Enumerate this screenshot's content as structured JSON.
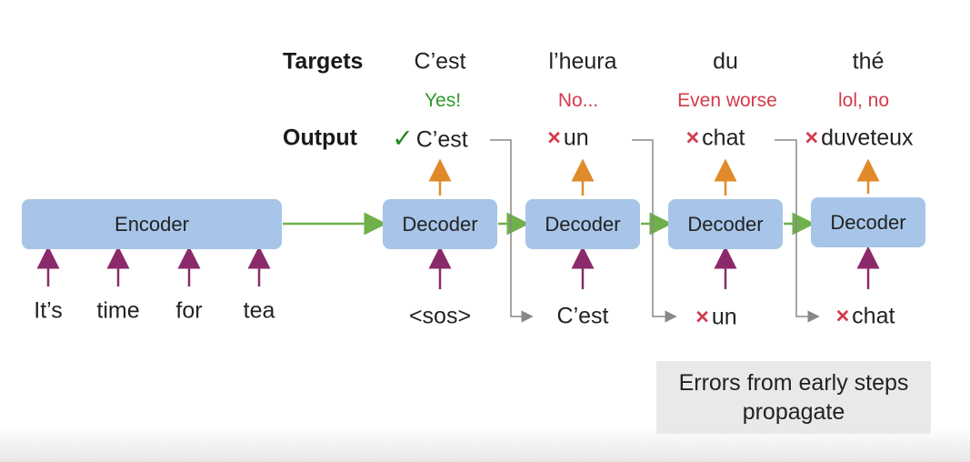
{
  "row_labels": {
    "targets": "Targets",
    "output": "Output"
  },
  "targets": [
    "C’est",
    "l’heura",
    "du",
    "thé"
  ],
  "comments": [
    {
      "text": "Yes!",
      "color": "#2e9a2e"
    },
    {
      "text": "No...",
      "color": "#d33a4a"
    },
    {
      "text": "Even worse",
      "color": "#d33a4a"
    },
    {
      "text": "lol, no",
      "color": "#d33a4a"
    }
  ],
  "outputs": [
    {
      "mark": "✓",
      "text": "C’est"
    },
    {
      "mark": "×",
      "text": "un"
    },
    {
      "mark": "×",
      "text": "chat"
    },
    {
      "mark": "×",
      "text": "duveteux"
    }
  ],
  "encoder": {
    "label": "Encoder"
  },
  "decoders": [
    "Decoder",
    "Decoder",
    "Decoder",
    "Decoder"
  ],
  "encoder_inputs": [
    "It’s",
    "time",
    "for",
    "tea"
  ],
  "decoder_inputs": [
    {
      "mark": "",
      "text": "<sos>"
    },
    {
      "mark": "",
      "text": "C’est"
    },
    {
      "mark": "×",
      "text": "un"
    },
    {
      "mark": "×",
      "text": "chat"
    }
  ],
  "note": {
    "line1": "Errors from early steps",
    "line2": "propagate"
  },
  "colors": {
    "block": "#a7c5e8",
    "input_arrow": "#8b2a6a",
    "output_arrow": "#e08a2a",
    "flow_arrow": "#6fb04a",
    "feed_line": "#888888"
  }
}
